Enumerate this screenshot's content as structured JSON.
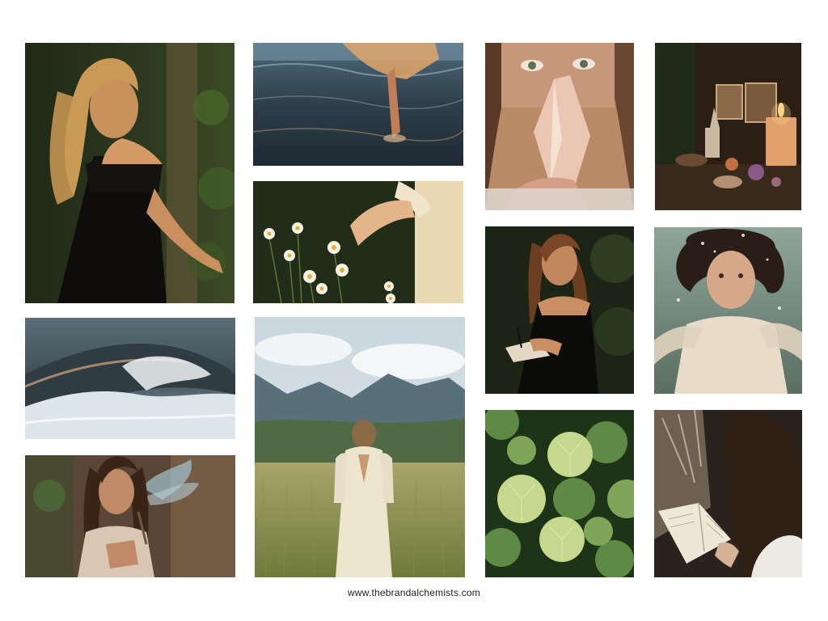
{
  "footer": {
    "website": "www.thebrandalchemists.com"
  },
  "tiles": [
    {
      "name": "woman-black-dress-ivy-photo",
      "subject": "woman-in-black-dress"
    },
    {
      "name": "feet-in-water-photo",
      "subject": "wading-feet"
    },
    {
      "name": "woman-holding-crystal-photo",
      "subject": "crystal-portrait"
    },
    {
      "name": "candle-altar-photo",
      "subject": "altar"
    },
    {
      "name": "hand-picking-daisies-photo",
      "subject": "daisies"
    },
    {
      "name": "woman-journaling-photo",
      "subject": "journaling"
    },
    {
      "name": "woman-underwater-photo",
      "subject": "underwater"
    },
    {
      "name": "ocean-wave-photo",
      "subject": "wave"
    },
    {
      "name": "woman-mountain-meadow-photo",
      "subject": "meadow"
    },
    {
      "name": "green-leaves-photo",
      "subject": "leaves"
    },
    {
      "name": "woman-smoke-cleansing-photo",
      "subject": "smoke"
    },
    {
      "name": "woman-reading-book-photo",
      "subject": "reading"
    }
  ]
}
